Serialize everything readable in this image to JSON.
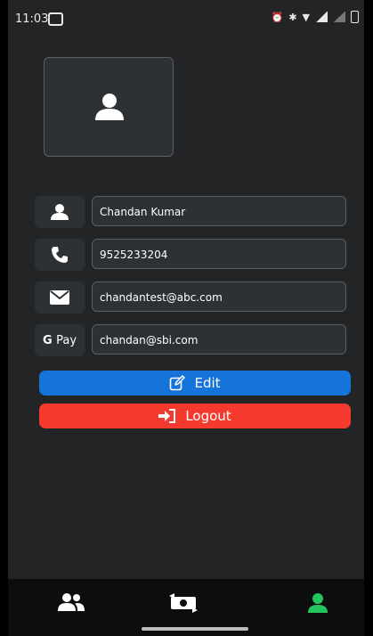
{
  "status": {
    "time": "11:03"
  },
  "profile": {
    "name": "Chandan Kumar",
    "phone": "9525233204",
    "email": "chandantest@abc.com",
    "upi_label_g": "G",
    "upi_label_pay": "Pay",
    "upi": "chandan@sbi.com"
  },
  "actions": {
    "edit_label": "Edit",
    "logout_label": "Logout"
  },
  "colors": {
    "edit": "#1673d9",
    "logout": "#f4392e",
    "active_nav": "#22c55e"
  },
  "nav": {
    "items": [
      {
        "icon": "users-icon"
      },
      {
        "icon": "money-transfer-icon"
      },
      {
        "icon": "user-icon",
        "active": true
      }
    ]
  }
}
